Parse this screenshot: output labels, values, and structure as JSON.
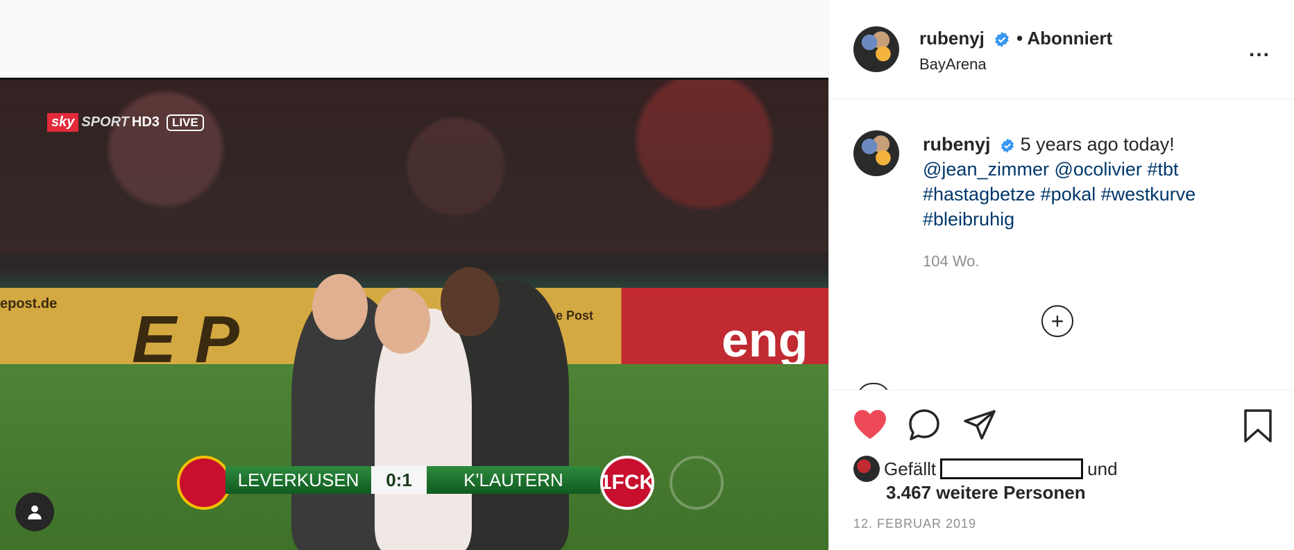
{
  "media": {
    "broadcaster": {
      "sky": "sky",
      "sport": "SPORT",
      "hd": "HD3",
      "live": "LIVE"
    },
    "scoreboard": {
      "home": "LEVERKUSEN",
      "score": "0:1",
      "away": "K'LAUTERN",
      "away_crest": "1FCK"
    },
    "ads": {
      "ep": "E P",
      "eng": "eng",
      "post_url": "epost.de",
      "post_brand": "he Post"
    }
  },
  "header": {
    "username": "rubenyj",
    "follow_label": "• Abonniert",
    "location": "BayArena",
    "more_label": "..."
  },
  "caption": {
    "username": "rubenyj",
    "text": "5 years ago today!",
    "mentions": [
      "@jean_zimmer",
      "@ocolivier"
    ],
    "hashtags": [
      "#tbt",
      "#hastagbetze",
      "#pokal",
      "#westkurve",
      "#bleibruhig"
    ],
    "time_ago": "104 Wo."
  },
  "actions": {
    "likes_prefix": "Gefällt",
    "likes_and": "und",
    "likes_count": "3.467 weitere Personen",
    "date": "12. FEBRUAR 2019"
  },
  "colors": {
    "like_red": "#ed4956",
    "tag_blue": "#00376b",
    "verified_blue": "#3897f0"
  },
  "icons": [
    "heart-icon",
    "comment-icon",
    "share-icon",
    "bookmark-icon",
    "add-comment-icon",
    "person-icon",
    "verified-badge-icon",
    "more-options-icon"
  ]
}
